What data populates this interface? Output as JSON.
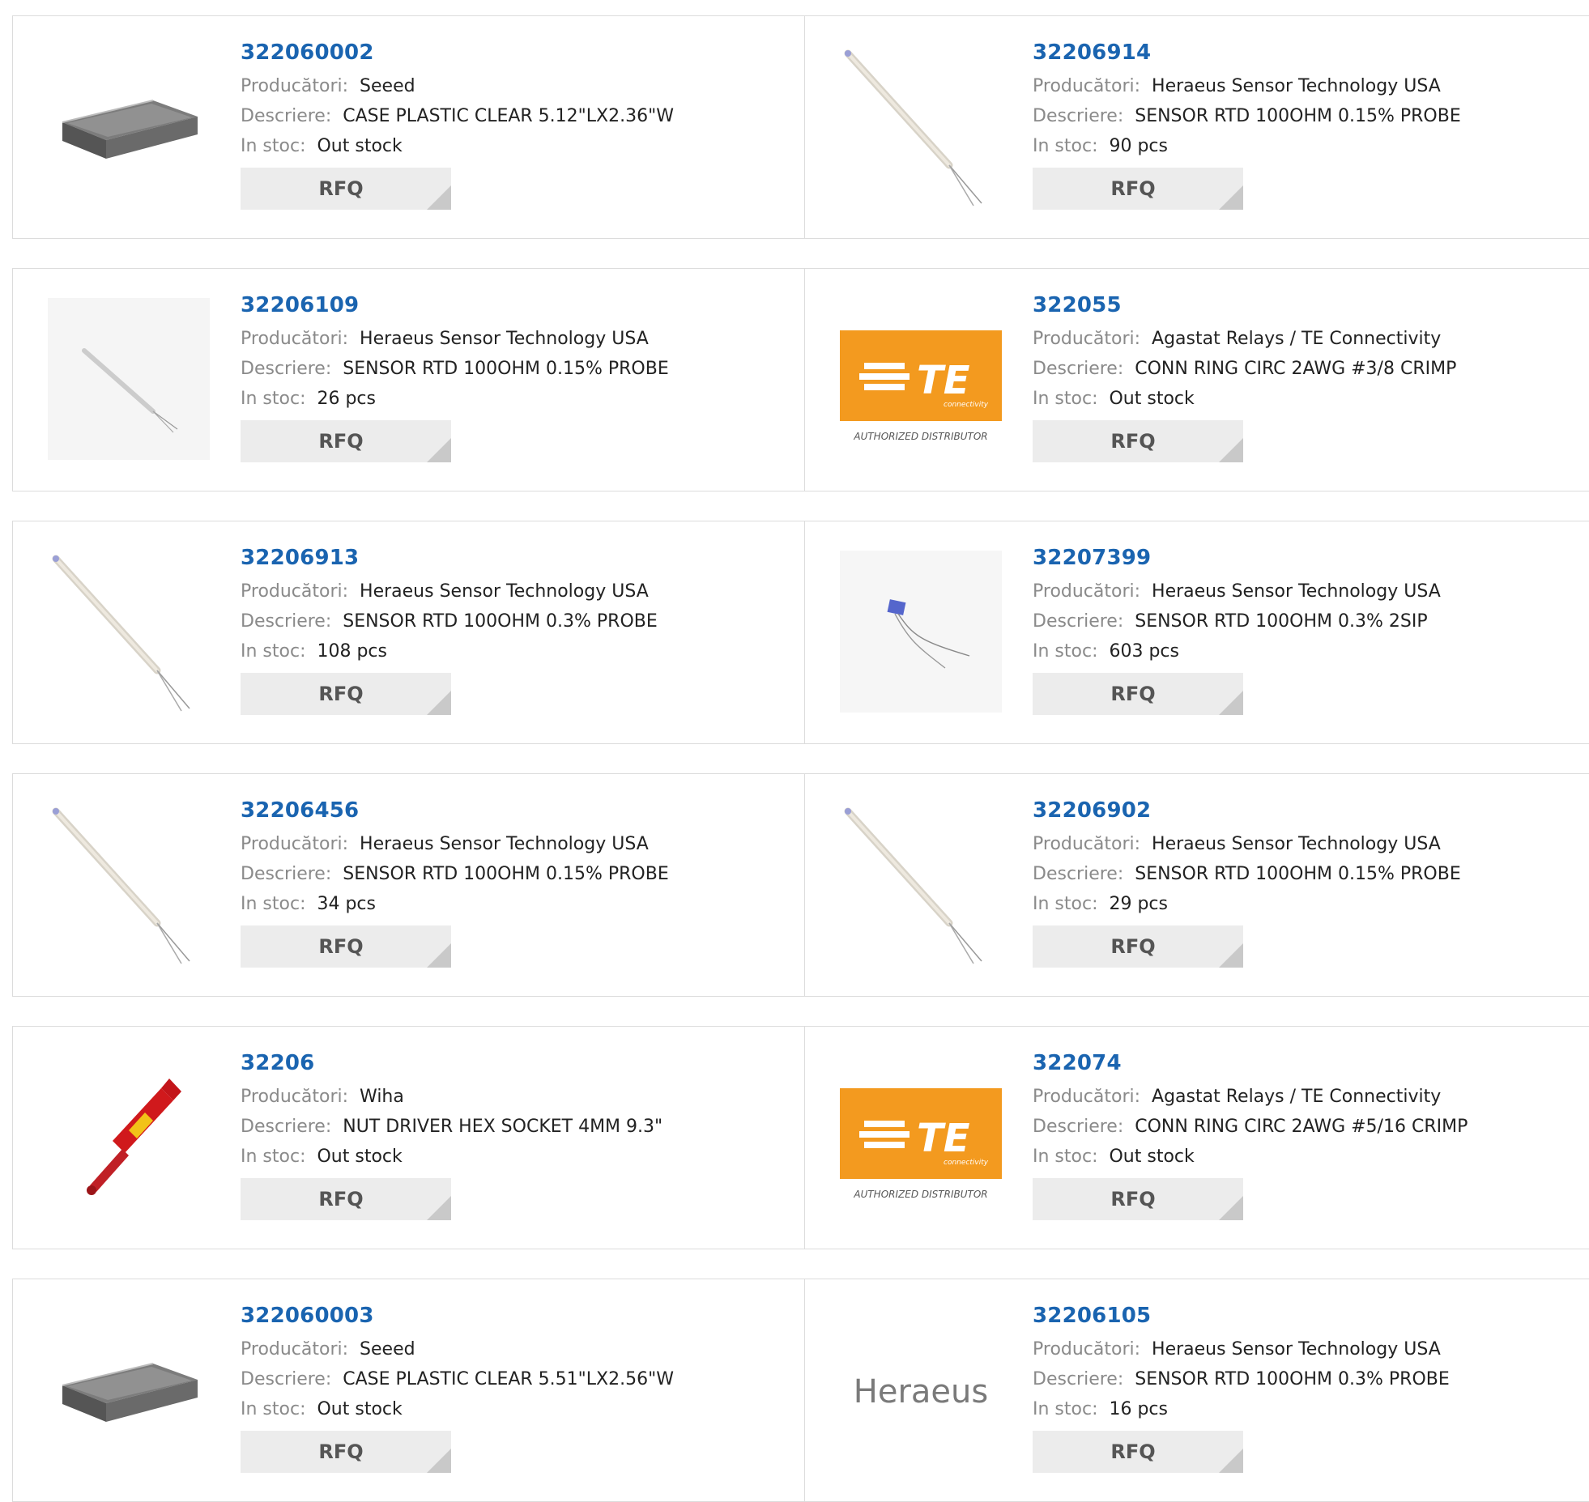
{
  "labels": {
    "manufacturer": "Producători:",
    "description": "Descriere:",
    "stock": "In stoc:",
    "rfq": "RFQ"
  },
  "rows": [
    [
      {
        "part": "322060002",
        "manufacturer": "Seeed",
        "description": "CASE PLASTIC CLEAR 5.12\"LX2.36\"W",
        "stock": "Out stock",
        "image": "plastic-case"
      },
      {
        "part": "32206914",
        "manufacturer": "Heraeus Sensor Technology USA",
        "description": "SENSOR RTD 100OHM 0.15% PROBE",
        "stock": "90 pcs",
        "image": "rtd-probe"
      }
    ],
    [
      {
        "part": "32206109",
        "manufacturer": "Heraeus Sensor Technology USA",
        "description": "SENSOR RTD 100OHM 0.15% PROBE",
        "stock": "26 pcs",
        "image": "rtd-probe-small"
      },
      {
        "part": "322055",
        "manufacturer": "Agastat Relays / TE Connectivity",
        "description": "CONN RING CIRC 2AWG #3/8 CRIMP",
        "stock": "Out stock",
        "image": "te-logo",
        "logo_sub": "connectivity",
        "logo_caption": "AUTHORIZED DISTRIBUTOR"
      }
    ],
    [
      {
        "part": "32206913",
        "manufacturer": "Heraeus Sensor Technology USA",
        "description": "SENSOR RTD 100OHM 0.3% PROBE",
        "stock": "108 pcs",
        "image": "rtd-probe"
      },
      {
        "part": "32207399",
        "manufacturer": "Heraeus Sensor Technology USA",
        "description": "SENSOR RTD 100OHM 0.3% 2SIP",
        "stock": "603 pcs",
        "image": "rtd-sip"
      }
    ],
    [
      {
        "part": "32206456",
        "manufacturer": "Heraeus Sensor Technology USA",
        "description": "SENSOR RTD 100OHM 0.15% PROBE",
        "stock": "34 pcs",
        "image": "rtd-probe"
      },
      {
        "part": "32206902",
        "manufacturer": "Heraeus Sensor Technology USA",
        "description": "SENSOR RTD 100OHM 0.15% PROBE",
        "stock": "29 pcs",
        "image": "rtd-probe"
      }
    ],
    [
      {
        "part": "32206",
        "manufacturer": "Wiha",
        "description": "NUT DRIVER HEX SOCKET 4MM 9.3\"",
        "stock": "Out stock",
        "image": "nut-driver"
      },
      {
        "part": "322074",
        "manufacturer": "Agastat Relays / TE Connectivity",
        "description": "CONN RING CIRC 2AWG #5/16 CRIMP",
        "stock": "Out stock",
        "image": "te-logo",
        "logo_sub": "connectivity",
        "logo_caption": "AUTHORIZED DISTRIBUTOR"
      }
    ],
    [
      {
        "part": "322060003",
        "manufacturer": "Seeed",
        "description": "CASE PLASTIC CLEAR 5.51\"LX2.56\"W",
        "stock": "Out stock",
        "image": "plastic-case"
      },
      {
        "part": "32206105",
        "manufacturer": "Heraeus Sensor Technology USA",
        "description": "SENSOR RTD 100OHM 0.3% PROBE",
        "stock": "16 pcs",
        "image": "heraeus-logo",
        "logo_text": "Heraeus"
      }
    ]
  ],
  "colors": {
    "link": "#1a64b0",
    "label": "#8a8a8a",
    "te_orange": "#f39a1f",
    "rfq_bg": "#ececec"
  }
}
